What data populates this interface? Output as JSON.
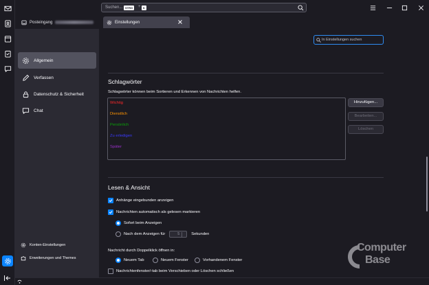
{
  "app": {
    "accent": "#0a84ff",
    "background": "#1c1b22"
  },
  "spaces": [
    {
      "name": "mail",
      "icon": "mail-icon"
    },
    {
      "name": "address-book",
      "icon": "address-book-icon"
    },
    {
      "name": "calendar",
      "icon": "calendar-icon"
    },
    {
      "name": "tasks",
      "icon": "tasks-icon"
    },
    {
      "name": "chat",
      "icon": "chat-icon"
    }
  ],
  "search": {
    "placeholder": "Suchen...",
    "shortcut_key1": "STRG",
    "shortcut_plus": "+",
    "shortcut_key2": "K"
  },
  "tabs": [
    {
      "label": "Posteingang",
      "icon": "inbox-icon",
      "active": false
    },
    {
      "label": "Einstellungen",
      "icon": "gear-icon",
      "active": true
    }
  ],
  "nav": {
    "items": [
      {
        "label": "Allgemein",
        "icon": "gear-icon",
        "selected": true
      },
      {
        "label": "Verfassen",
        "icon": "pencil-icon",
        "selected": false
      },
      {
        "label": "Datenschutz & Sicherheit",
        "icon": "lock-icon",
        "selected": false
      },
      {
        "label": "Chat",
        "icon": "chat-icon",
        "selected": false
      }
    ],
    "footer": [
      {
        "label": "Konten-Einstellungen",
        "icon": "account-settings-icon"
      },
      {
        "label": "Erweiterungen und Themes",
        "icon": "puzzle-icon"
      }
    ]
  },
  "find": {
    "placeholder": "In Einstellungen suchen"
  },
  "tags": {
    "title": "Schlagwörter",
    "description": "Schlagwörter können beim Sortieren und Erkennen von Nachrichten helfen.",
    "items": [
      {
        "label": "Wichtig",
        "color": "#ff2a2a"
      },
      {
        "label": "Dienstlich",
        "color": "#ff9400"
      },
      {
        "label": "Persönlich",
        "color": "#0aa10a"
      },
      {
        "label": "Zu erledigen",
        "color": "#3a3aff"
      },
      {
        "label": "Später",
        "color": "#9a2fc9"
      }
    ],
    "buttons": {
      "add": "Hinzufügen...",
      "edit": "Bearbeiten...",
      "delete": "Löschen"
    }
  },
  "reading": {
    "title": "Lesen & Ansicht",
    "inline_attachments": {
      "label": "Anhänge eingebunden anzeigen",
      "checked": true
    },
    "auto_mark_read": {
      "label": "Nachrichten automatisch als gelesen markieren",
      "checked": true
    },
    "immediately": {
      "label": "Sofort beim Anzeigen",
      "selected": true
    },
    "after_delay": {
      "label": "Nach dem Anzeigen für",
      "selected": false,
      "value": "5",
      "unit": "Sekunden"
    },
    "double_click_label": "Nachricht durch Doppelklick öffnen in:",
    "open_options": [
      {
        "label": "Neuem Tab",
        "selected": true
      },
      {
        "label": "Neuem Fenster",
        "selected": false
      },
      {
        "label": "Vorhandenem Fenster",
        "selected": false
      }
    ],
    "close_on_move": {
      "label": "Nachrichtenfenster/-tab beim Verschieben oder Löschen schließen",
      "checked": false
    }
  },
  "watermark": {
    "line1": "Computer",
    "line2": "Base"
  }
}
